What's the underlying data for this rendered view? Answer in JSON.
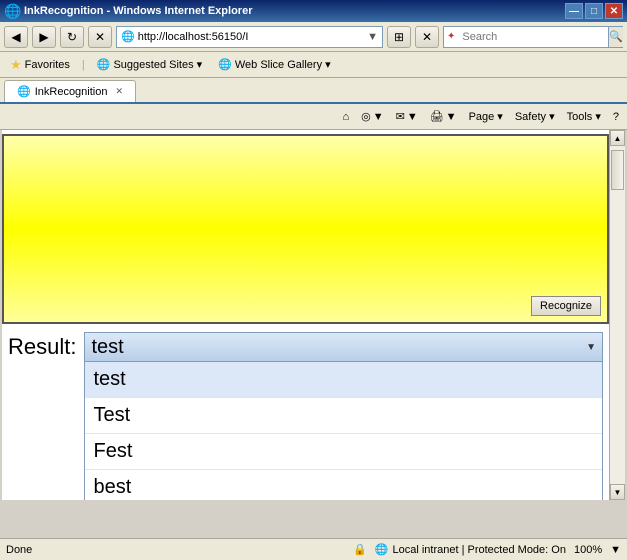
{
  "titleBar": {
    "title": "InkRecognition - Windows Internet Explorer",
    "ieIcon": "🌐",
    "controls": [
      "—",
      "□",
      "✕"
    ]
  },
  "navBar": {
    "backBtn": "◀",
    "forwardBtn": "▶",
    "refreshBtn": "↻",
    "stopBtn": "✕",
    "url": "http://localhost:56150/I",
    "searchPlaceholder": "Search",
    "searchBtnIcon": "🔍"
  },
  "favBar": {
    "favoritesLabel": "Favorites",
    "starIcon": "★",
    "suggestedLabel": "Suggested Sites ▾",
    "webSliceLabel": "Web Slice Gallery ▾"
  },
  "tab": {
    "icon": "🌐",
    "label": "InkRecognition"
  },
  "toolbar": {
    "homeLabel": "⌂",
    "feedLabel": "◎",
    "printLabel": "🖨",
    "pageLabel": "Page ▾",
    "safetyLabel": "Safety ▾",
    "toolsLabel": "Tools ▾",
    "helpLabel": "?"
  },
  "recognizeBtn": "Recognize",
  "resultLabel": "Result:",
  "dropdown": {
    "selected": "test",
    "options": [
      "test",
      "Test",
      "Fest",
      "best"
    ]
  },
  "statusBar": {
    "status": "Done",
    "zone": "Local intranet | Protected Mode: On",
    "zoom": "100%"
  }
}
